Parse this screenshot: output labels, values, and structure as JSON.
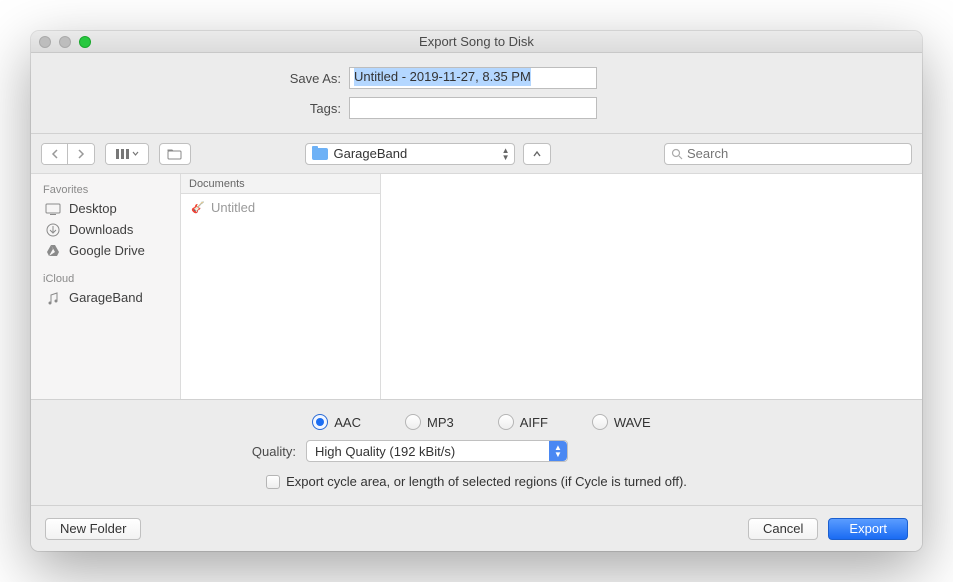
{
  "title": "Export Song to Disk",
  "form": {
    "saveAsLabel": "Save As:",
    "saveAsValue": "Untitled - 2019-11-27, 8.35 PM",
    "tagsLabel": "Tags:",
    "tagsValue": ""
  },
  "toolbar": {
    "locationFolder": "GarageBand",
    "searchPlaceholder": "Search"
  },
  "sidebar": {
    "sections": [
      {
        "title": "Favorites",
        "items": [
          {
            "icon": "desktop",
            "label": "Desktop"
          },
          {
            "icon": "downloads",
            "label": "Downloads"
          },
          {
            "icon": "drive",
            "label": "Google Drive"
          }
        ]
      },
      {
        "title": "iCloud",
        "items": [
          {
            "icon": "garageband",
            "label": "GarageBand"
          }
        ]
      }
    ]
  },
  "column": {
    "header": "Documents",
    "items": [
      {
        "label": "Untitled"
      }
    ]
  },
  "formats": {
    "items": [
      {
        "label": "AAC",
        "selected": true
      },
      {
        "label": "MP3",
        "selected": false
      },
      {
        "label": "AIFF",
        "selected": false
      },
      {
        "label": "WAVE",
        "selected": false
      }
    ]
  },
  "quality": {
    "label": "Quality:",
    "value": "High Quality (192 kBit/s)"
  },
  "exportCycle": {
    "label": "Export cycle area, or length of selected regions (if Cycle is turned off).",
    "checked": false
  },
  "buttons": {
    "newFolder": "New Folder",
    "cancel": "Cancel",
    "export": "Export"
  }
}
